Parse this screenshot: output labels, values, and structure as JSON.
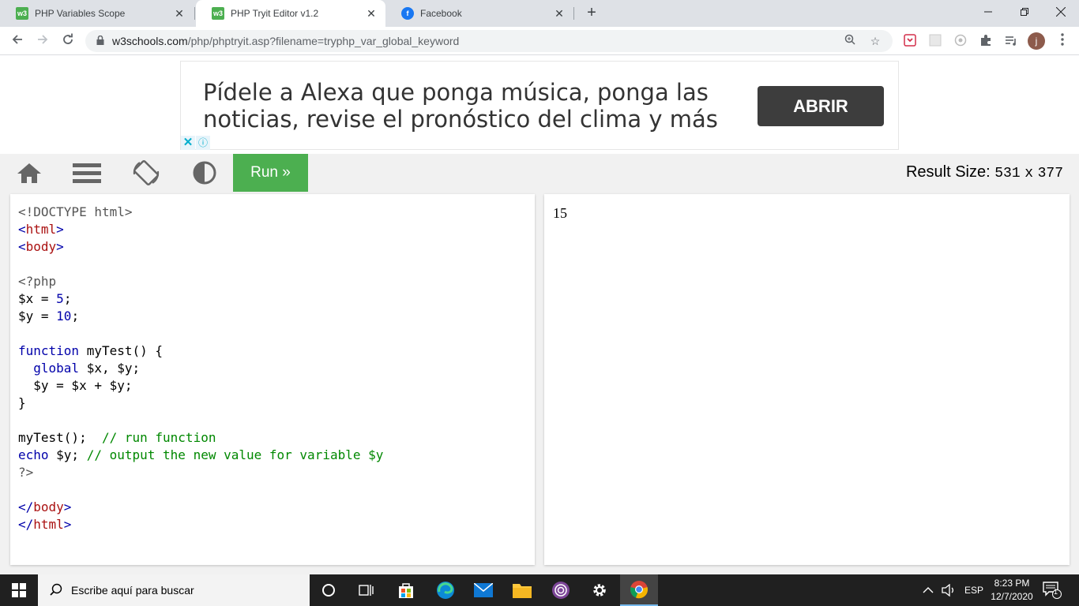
{
  "browser": {
    "tabs": [
      {
        "title": "PHP Variables Scope",
        "favicon": "w3schools-icon",
        "active": false
      },
      {
        "title": "PHP Tryit Editor v1.2",
        "favicon": "w3schools-icon",
        "active": true
      },
      {
        "title": "Facebook",
        "favicon": "facebook-icon",
        "active": false
      }
    ],
    "favicon_label": "w3",
    "close_glyph": "✕",
    "new_tab_glyph": "+",
    "url_host": "w3schools.com",
    "url_path": "/php/phptryit.asp?filename=tryphp_var_global_keyword",
    "profile_initial": "j"
  },
  "ad": {
    "text": "Pídele a Alexa que ponga música, ponga las noticias, revise el pronóstico del clima y más",
    "button_label": "ABRIR"
  },
  "editor": {
    "run_label": "Run »",
    "result_size_label": "Result Size:",
    "result_width": "531",
    "result_x": "x",
    "result_height": "377",
    "output": "15"
  },
  "taskbar": {
    "search_placeholder": "Escribe aquí para buscar",
    "language": "ESP",
    "time": "8:23 PM",
    "date": "12/7/2020",
    "notification_count": "1"
  },
  "colors": {
    "run_green": "#4caf50",
    "taskbar_bg": "#202020",
    "tabstrip_bg": "#dee1e6"
  }
}
